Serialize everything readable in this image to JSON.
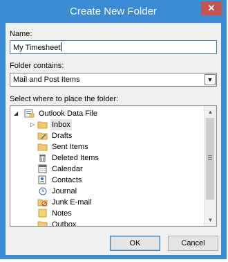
{
  "window": {
    "title": "Create New Folder",
    "close_glyph": "✕"
  },
  "name": {
    "label": "Name:",
    "value": "My Timesheet"
  },
  "folder_contains": {
    "label": "Folder contains:",
    "selected": "Mail and Post Items"
  },
  "tree": {
    "label": "Select where to place the folder:",
    "root": {
      "label": "Outlook Data File",
      "icon": "data-file-icon",
      "expander": "◢"
    },
    "items": [
      {
        "label": "Inbox",
        "icon": "inbox-folder-icon",
        "selected": true,
        "expander": "▷"
      },
      {
        "label": "Drafts",
        "icon": "drafts-folder-icon"
      },
      {
        "label": "Sent Items",
        "icon": "sent-items-folder-icon"
      },
      {
        "label": "Deleted Items",
        "icon": "deleted-items-icon"
      },
      {
        "label": "Calendar",
        "icon": "calendar-icon"
      },
      {
        "label": "Contacts",
        "icon": "contacts-icon"
      },
      {
        "label": "Journal",
        "icon": "journal-icon"
      },
      {
        "label": "Junk E-mail",
        "icon": "junk-email-icon"
      },
      {
        "label": "Notes",
        "icon": "notes-icon"
      },
      {
        "label": "Outbox",
        "icon": "outbox-icon"
      }
    ]
  },
  "buttons": {
    "ok": "OK",
    "cancel": "Cancel"
  },
  "colors": {
    "titlebar": "#3a8ad4",
    "close": "#c75050",
    "folder": "#f5c96a",
    "selection": "#e5e5e5"
  }
}
